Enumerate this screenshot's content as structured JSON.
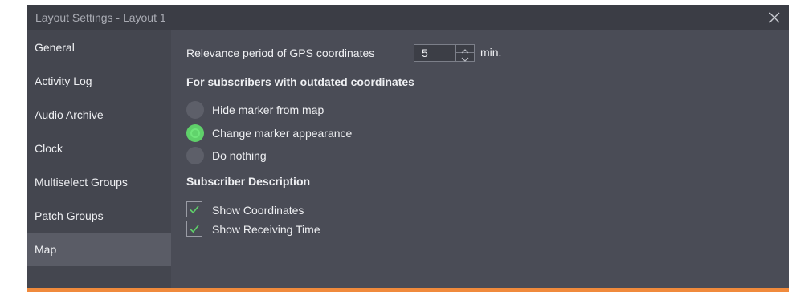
{
  "window": {
    "title": "Layout Settings - Layout 1"
  },
  "sidebar": {
    "items": [
      {
        "label": "General"
      },
      {
        "label": "Activity Log"
      },
      {
        "label": "Audio Archive"
      },
      {
        "label": "Clock"
      },
      {
        "label": "Multiselect Groups"
      },
      {
        "label": "Patch Groups"
      },
      {
        "label": "Map",
        "active": true
      }
    ]
  },
  "map": {
    "relevance_label": "Relevance period of GPS coordinates",
    "relevance_value": "5",
    "relevance_unit": "min.",
    "outdated_title": "For subscribers with outdated coordinates",
    "outdated_options": [
      {
        "label": "Hide marker from map",
        "selected": false
      },
      {
        "label": "Change marker appearance",
        "selected": true
      },
      {
        "label": "Do nothing",
        "selected": false
      }
    ],
    "description_title": "Subscriber Description",
    "description_options": [
      {
        "label": "Show Coordinates",
        "checked": true
      },
      {
        "label": "Show Receiving Time",
        "checked": true
      }
    ]
  },
  "colors": {
    "accent_green": "#5fd06a",
    "accent_orange": "#f08a3c",
    "background": "#4a4c56"
  },
  "icons": {
    "close": "close-icon",
    "spin_up": "chevron-up-icon",
    "spin_down": "chevron-down-icon",
    "checkmark": "checkmark-icon"
  }
}
